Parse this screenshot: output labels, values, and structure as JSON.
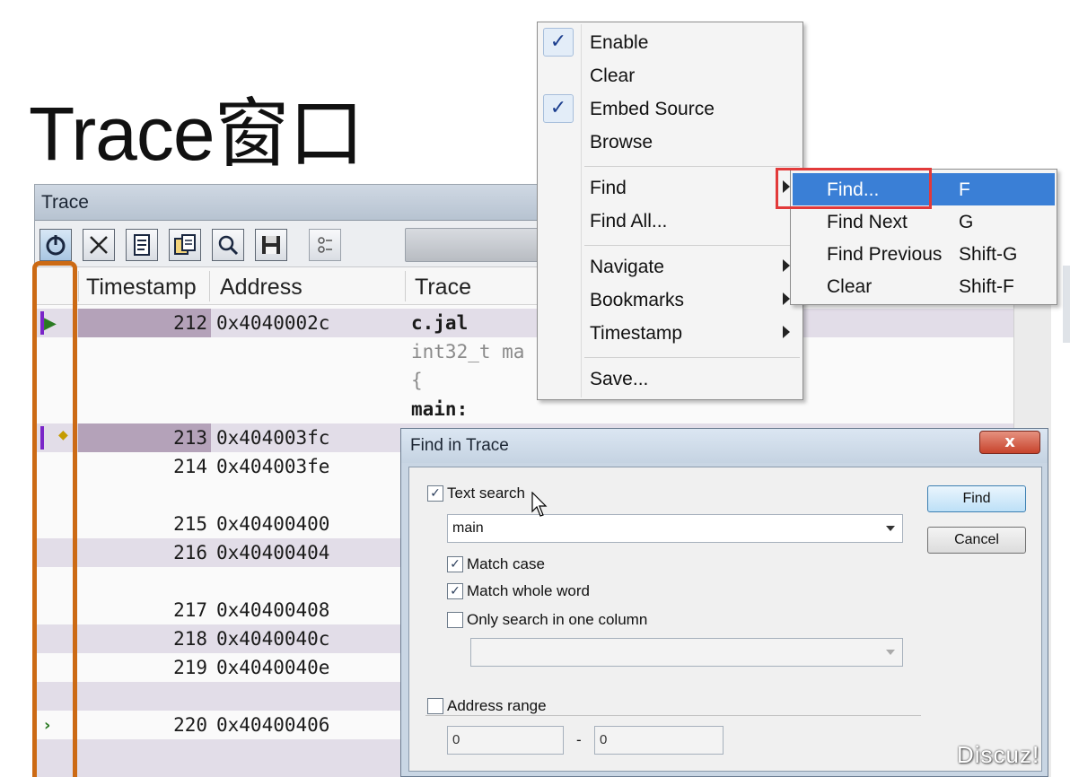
{
  "slide": {
    "title": "Trace窗口"
  },
  "trace_window": {
    "title": "Trace",
    "toolbar": [
      "power-icon",
      "clear-icon",
      "embed-source-icon",
      "browse-icon",
      "find-icon",
      "save-icon",
      "bookmark-icon"
    ],
    "columns": {
      "timestamp": "Timestamp",
      "address": "Address",
      "trace": "Trace"
    },
    "rows": [
      {
        "ts": "212",
        "addr": "0x4040002c",
        "trace": "c.jal"
      },
      {
        "ts": "",
        "addr": "",
        "trace": "int32_t ma"
      },
      {
        "ts": "",
        "addr": "",
        "trace": "{"
      },
      {
        "ts": "",
        "addr": "",
        "trace": "main:"
      },
      {
        "ts": "213",
        "addr": "0x404003fc",
        "trace": ""
      },
      {
        "ts": "214",
        "addr": "0x404003fe",
        "trace": ""
      },
      {
        "ts": "215",
        "addr": "0x40400400",
        "trace": ""
      },
      {
        "ts": "216",
        "addr": "0x40400404",
        "trace": ""
      },
      {
        "ts": "217",
        "addr": "0x40400408",
        "trace": ""
      },
      {
        "ts": "218",
        "addr": "0x4040040c",
        "trace": ""
      },
      {
        "ts": "219",
        "addr": "0x4040040e",
        "trace": ""
      },
      {
        "ts": "220",
        "addr": "0x40400406",
        "trace": ""
      }
    ]
  },
  "context_menu": {
    "items": [
      {
        "label": "Enable",
        "checked": true
      },
      {
        "label": "Clear",
        "checked": false
      },
      {
        "label": "Embed Source",
        "checked": true
      },
      {
        "label": "Browse",
        "checked": false
      },
      {
        "label": "Find",
        "submenu": true
      },
      {
        "label": "Find All...",
        "submenu": false
      },
      {
        "label": "Navigate",
        "submenu": true
      },
      {
        "label": "Bookmarks",
        "submenu": true
      },
      {
        "label": "Timestamp",
        "submenu": true
      },
      {
        "label": "Save...",
        "submenu": false
      }
    ],
    "check_glyph": "✓"
  },
  "find_submenu": {
    "items": [
      {
        "label": "Find...",
        "key": "F",
        "active": true
      },
      {
        "label": "Find Next",
        "key": "G",
        "active": false
      },
      {
        "label": "Find Previous",
        "key": "Shift-G",
        "active": false
      },
      {
        "label": "Clear",
        "key": "Shift-F",
        "active": false
      }
    ]
  },
  "find_dialog": {
    "title": "Find in Trace",
    "close_glyph": "x",
    "text_search_label": "Text search",
    "text_search_checked": true,
    "search_value": "main",
    "match_case_label": "Match case",
    "match_case_checked": true,
    "match_whole_word_label": "Match whole word",
    "match_whole_word_checked": true,
    "one_column_label": "Only search in one column",
    "one_column_checked": false,
    "column_value": "",
    "address_range_label": "Address range",
    "address_range_checked": false,
    "address_from": "0",
    "address_sep": "-",
    "address_to": "0",
    "find_button": "Find",
    "cancel_button": "Cancel",
    "checkmark": "✓"
  },
  "watermark": "Discuz!"
}
